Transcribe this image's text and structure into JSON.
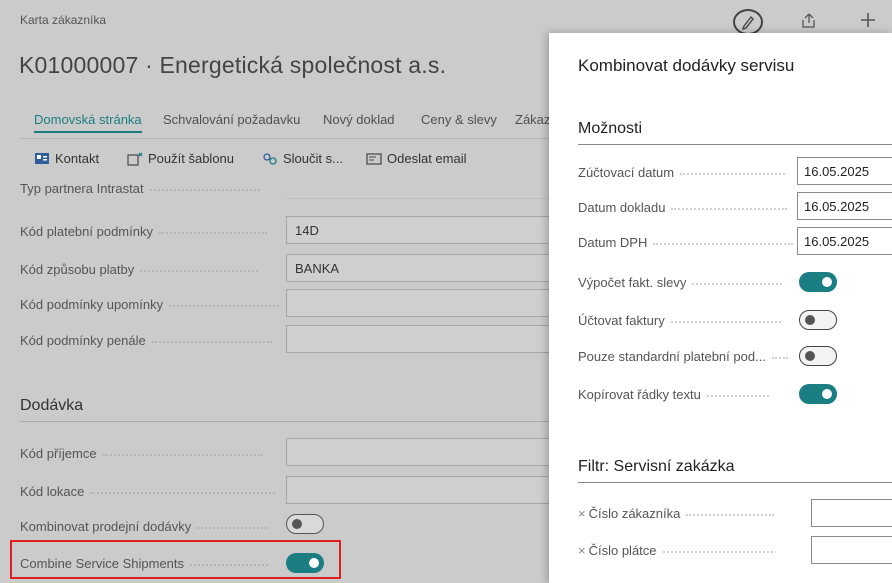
{
  "page": {
    "breadcrumb": "Karta zákazníka",
    "title": "K01000007 · Energetická společnost a.s."
  },
  "tabs": [
    {
      "label": "Domovská stránka"
    },
    {
      "label": "Schvalování požadavku"
    },
    {
      "label": "Nový doklad"
    },
    {
      "label": "Ceny & slevy"
    },
    {
      "label": "Zákaz"
    }
  ],
  "actions": [
    {
      "label": "Kontakt",
      "icon": "contact-card-icon"
    },
    {
      "label": "Použít šablonu",
      "icon": "template-icon"
    },
    {
      "label": "Sloučit s...",
      "icon": "merge-icon"
    },
    {
      "label": "Odeslat email",
      "icon": "email-icon"
    }
  ],
  "fields": [
    {
      "label": "Typ partnera Intrastat",
      "value": ""
    },
    {
      "label": "Kód platební podmínky",
      "value": "14D"
    },
    {
      "label": "Kód způsobu platby",
      "value": "BANKA"
    },
    {
      "label": "Kód podmínky upomínky",
      "value": ""
    },
    {
      "label": "Kód podmínky penále",
      "value": ""
    }
  ],
  "delivery": {
    "heading": "Dodávka",
    "fields": [
      {
        "label": "Kód příjemce",
        "value": ""
      },
      {
        "label": "Kód lokace",
        "value": ""
      },
      {
        "label": "Kombinovat prodejní dodávky",
        "toggle": false
      },
      {
        "label": "Combine Service Shipments",
        "toggle": true
      }
    ]
  },
  "header_icons": [
    "edit-icon",
    "share-icon",
    "add-icon"
  ],
  "dialog": {
    "title": "Kombinovat dodávky servisu",
    "options_heading": "Možnosti",
    "options": [
      {
        "label": "Zúčtovací datum",
        "value": "16.05.2025"
      },
      {
        "label": "Datum dokladu",
        "value": "16.05.2025"
      },
      {
        "label": "Datum DPH",
        "value": "16.05.2025"
      },
      {
        "label": "Výpočet fakt. slevy",
        "toggle": true
      },
      {
        "label": "Účtovat faktury",
        "toggle": false
      },
      {
        "label": "Pouze standardní platební pod...",
        "toggle": false
      },
      {
        "label": "Kopírovat řádky textu",
        "toggle": true
      }
    ],
    "filter_heading": "Filtr: Servisní zakázka",
    "filters": [
      {
        "label": "Číslo zákazníka",
        "value": ""
      },
      {
        "label": "Číslo plátce",
        "value": ""
      }
    ]
  },
  "colors": {
    "accent": "#1b7e82",
    "highlight": "#e02020"
  }
}
